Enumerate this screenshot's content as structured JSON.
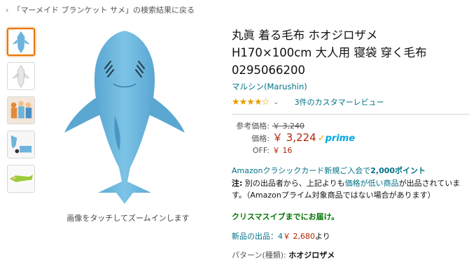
{
  "nav": {
    "back_arrow": "‹",
    "back_text": "「マーメイド ブランケット サメ」の検索結果に戻る"
  },
  "gallery": {
    "zoom_hint": "画像をタッチしてズームインします",
    "thumbnails": [
      "thumb-blue-shark",
      "thumb-white-shark",
      "thumb-people",
      "thumb-lifestyle",
      "thumb-green-shark"
    ]
  },
  "product": {
    "title_lines": [
      "丸眞 着る毛布 ホオジロザメ",
      "H170×100cm 大人用 寝袋 穿く毛布",
      "0295066200"
    ],
    "brand": "マルシン(Marushin)",
    "stars": "★★★★☆",
    "reviews": "3件のカスタマーレビュー"
  },
  "price": {
    "list_label": "参考価格:",
    "list_value": "￥ 3,240",
    "price_label": "価格:",
    "price_value": "￥ 3,224",
    "prime_label": "prime",
    "off_label": "OFF:",
    "off_value": "￥ 16"
  },
  "card": {
    "text": "Amazonクラシックカード新規ご入会で",
    "points": "2,000ポイント"
  },
  "note": {
    "label": "注:",
    "text1": " 別の出品者から、上記よりも",
    "link": "価格が低い商品",
    "text2": "が出品されています。（Amazonプライム対象商品ではない場合があります）"
  },
  "delivery": {
    "text": "クリスマスイブまでにお届け。"
  },
  "new_items": {
    "label": "新品の出品：4",
    "amount": "￥ 2,680",
    "suffix": "より"
  },
  "pattern": {
    "label": "パターン(種類):",
    "value": "ホオジロザメ"
  },
  "colors": {
    "link": "#007185",
    "price": "#b12704",
    "star": "#e59f00",
    "prime": "#00a8e1",
    "shark_blue": "#6cb4dc",
    "delivery": "#007600"
  }
}
